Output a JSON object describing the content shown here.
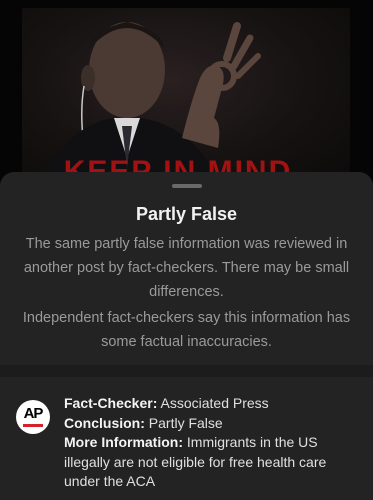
{
  "background_post": {
    "caption_fragment": "KEEP IN MIND"
  },
  "sheet": {
    "title": "Partly False",
    "description_1": "The same partly false information was reviewed in another post by fact-checkers. There may be small differences.",
    "description_2": "Independent fact-checkers say this information has some factual inaccuracies."
  },
  "fact_check": {
    "logo_text": "AP",
    "checker_label": "Fact-Checker:",
    "checker_value": "Associated Press",
    "conclusion_label": "Conclusion:",
    "conclusion_value": "Partly False",
    "more_info_label": "More Information:",
    "more_info_value": "Immigrants in the US illegally are not eligible for free health care under the ACA"
  },
  "colors": {
    "sheet_background": "#232324",
    "ap_red": "#d3222a",
    "caption_red": "#b31212"
  }
}
